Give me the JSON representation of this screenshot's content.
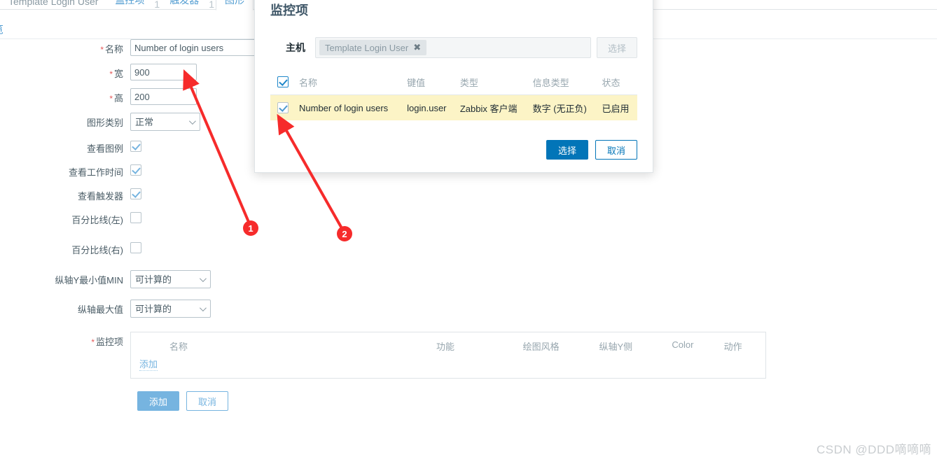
{
  "tabstrip": {
    "template_name": "Template Login User",
    "items": [
      {
        "label": "监控项",
        "type": "link"
      },
      {
        "label": "触发器",
        "type": "link"
      },
      {
        "label": "图形",
        "type": "active"
      }
    ],
    "separator": "1"
  },
  "breadcrumb": {
    "text": "览"
  },
  "form": {
    "fields": {
      "name": {
        "label": "名称",
        "required": true,
        "value": "Number of login users"
      },
      "width": {
        "label": "宽",
        "required": true,
        "value": "900"
      },
      "height": {
        "label": "高",
        "required": true,
        "value": "200"
      },
      "graph_type": {
        "label": "图形类别",
        "required": false,
        "value": "正常"
      },
      "show_legend": {
        "label": "查看图例",
        "required": false,
        "checked": true
      },
      "show_working_time": {
        "label": "查看工作时间",
        "required": false,
        "checked": true
      },
      "show_triggers": {
        "label": "查看触发器",
        "required": false,
        "checked": true
      },
      "percentile_left": {
        "label": "百分比线(左)",
        "required": false,
        "checked": false
      },
      "percentile_right": {
        "label": "百分比线(右)",
        "required": false,
        "checked": false
      },
      "ymin": {
        "label": "纵轴Y最小值MIN",
        "required": false,
        "value": "可计算的"
      },
      "ymax": {
        "label": "纵轴最大值",
        "required": false,
        "value": "可计算的"
      },
      "items": {
        "label": "监控项",
        "required": true
      }
    },
    "items_table": {
      "columns": [
        "名称",
        "功能",
        "绘图风格",
        "纵轴Y侧",
        "Color",
        "动作"
      ],
      "rows": [],
      "add_link": "添加"
    },
    "actions": {
      "submit": "添加",
      "cancel": "取消"
    }
  },
  "modal": {
    "title": "监控项",
    "host": {
      "label": "主机",
      "chip": "Template Login User",
      "remove_icon": "✖",
      "select_button": "选择"
    },
    "table": {
      "columns": [
        "名称",
        "键值",
        "类型",
        "信息类型",
        "状态"
      ],
      "header_checkbox": true,
      "rows": [
        {
          "checked": true,
          "name": "Number of login users",
          "key": "login.user",
          "type": "Zabbix 客户端",
          "value_type": "数字 (无正负)",
          "status": "已启用"
        }
      ]
    },
    "actions": {
      "confirm": "选择",
      "cancel": "取消"
    }
  },
  "annotations": [
    {
      "number": "1"
    },
    {
      "number": "2"
    }
  ],
  "watermark": "CSDN @DDD嘀嘀嘀",
  "colors": {
    "accent": "#0275b8",
    "link": "#4d9ad0",
    "required": "#e45959",
    "row_highlight": "#fcf4c6",
    "enabled": "#5ba836",
    "annotation": "#f62b2b"
  }
}
